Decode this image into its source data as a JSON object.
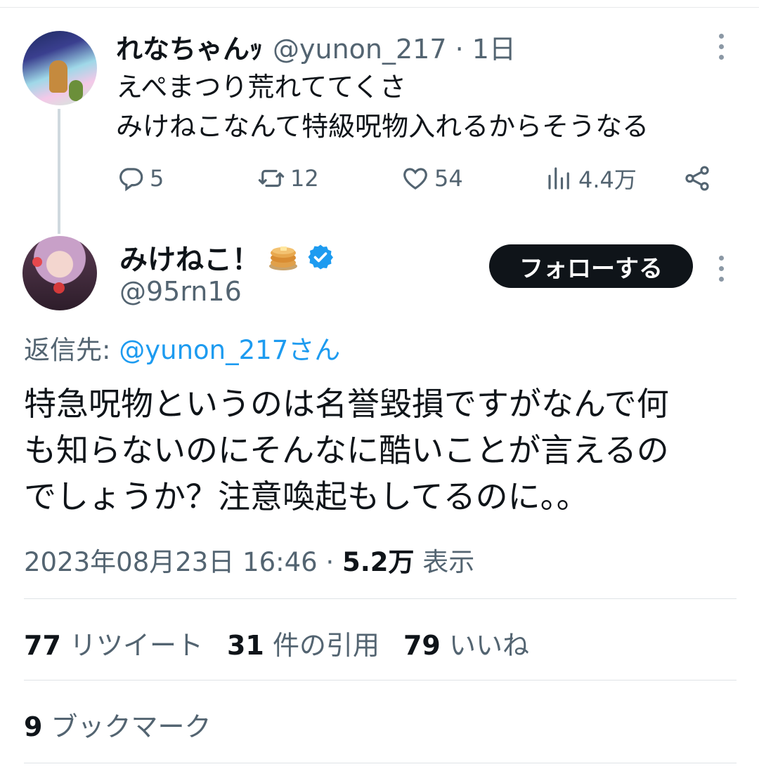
{
  "parent_tweet": {
    "display_name": "れなちゃんｯ",
    "meta": "@yunon_217 · 1日",
    "lines": [
      "えぺまつり荒れててくさ",
      "みけねこなんて特級呪物入れるからそうなる"
    ],
    "actions": {
      "replies": "5",
      "retweets": "12",
      "likes": "54",
      "views": "4.4万"
    }
  },
  "main_tweet": {
    "display_name": "みけねこ！",
    "handle": "@95rn16",
    "follow_label": "フォローする",
    "reply_to_prefix": "返信先: ",
    "reply_to_mention": "@yunon_217さん",
    "lines": [
      "特急呪物というのは名誉毀損ですがなんで何",
      "も知らないのにそんなに酷いことが言えるの",
      "でしょうか？注意喚起もしてるのに。。"
    ],
    "timestamp": "2023年08月23日 16:46 · ",
    "views_count": "5.2万",
    "views_label": " 表示",
    "stats": {
      "retweets_count": "77",
      "retweets_label": " リツイート",
      "quotes_count": "31",
      "quotes_label": " 件の引用",
      "likes_count": "79",
      "likes_label": " いいね",
      "bookmarks_count": "9",
      "bookmarks_label": " ブックマーク"
    }
  },
  "colors": {
    "text": "#0f1419",
    "secondary": "#536471",
    "link": "#1d9bf0",
    "button_bg": "#0f1419"
  }
}
